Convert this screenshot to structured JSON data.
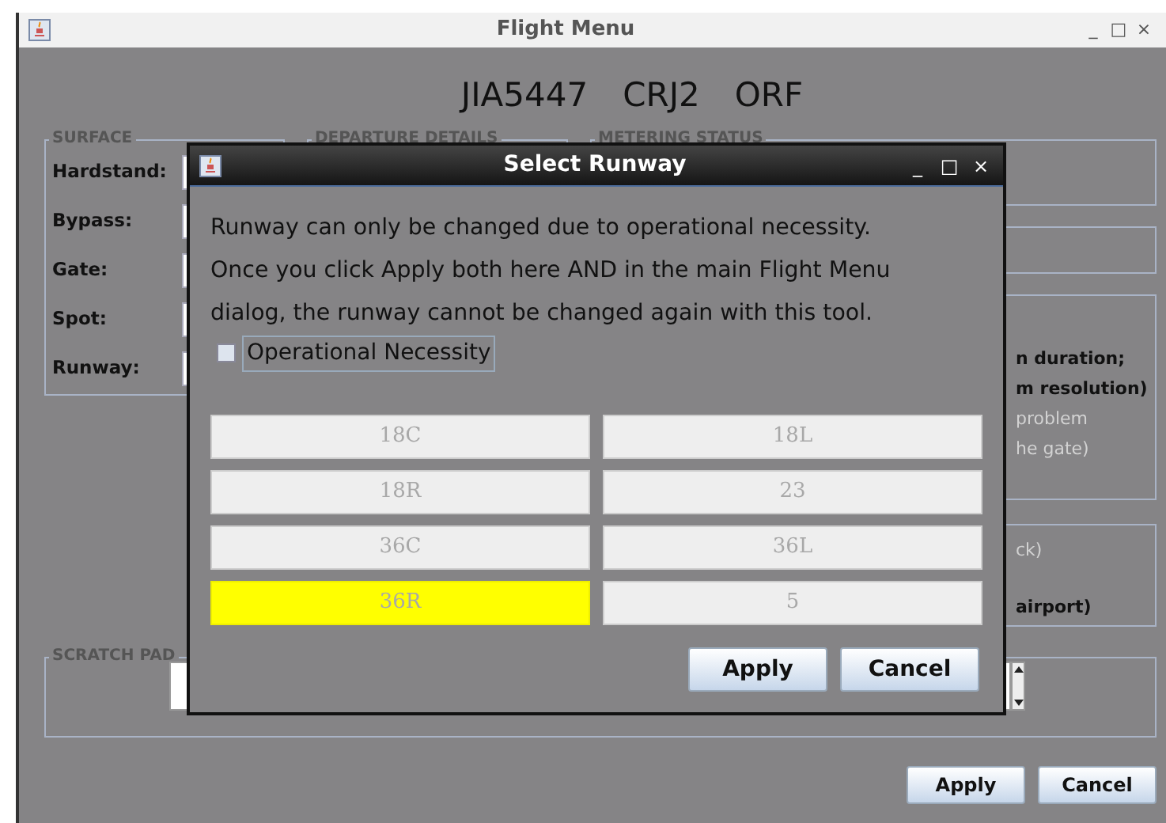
{
  "window": {
    "title": "Flight Menu",
    "controls": [
      "_",
      "□",
      "×"
    ]
  },
  "flight": {
    "callsign": "JIA5447",
    "aircraft": "CRJ2",
    "destination": "ORF"
  },
  "surface": {
    "legend": "SURFACE",
    "fields": [
      {
        "label": "Hardstand:"
      },
      {
        "label": "Bypass:"
      },
      {
        "label": "Gate:"
      },
      {
        "label": "Spot:"
      },
      {
        "label": "Runway:"
      }
    ]
  },
  "departure_details": {
    "legend": "DEPARTURE DETAILS"
  },
  "metering_status": {
    "legend": "METERING STATUS"
  },
  "status_panel": {
    "lines": [
      {
        "text": "n duration;",
        "disabled": false
      },
      {
        "text": "m resolution)",
        "disabled": false
      },
      {
        "text": "problem",
        "disabled": true
      },
      {
        "text": "he gate)",
        "disabled": true
      }
    ]
  },
  "location_panel": {
    "lines": [
      {
        "text": "ck)",
        "disabled": true
      },
      {
        "text": "airport)",
        "disabled": false
      }
    ]
  },
  "scratch_pad": {
    "legend": "SCRATCH PAD"
  },
  "buttons": [
    "Apply",
    "Cancel"
  ],
  "dialog": {
    "title": "Select Runway",
    "controls": [
      "_",
      "□",
      "×"
    ],
    "message": [
      "Runway can only be changed due to operational necessity.",
      "Once you click Apply both here AND in the main Flight Menu",
      "dialog, the runway cannot be changed again with this tool."
    ],
    "checkbox": {
      "label": "Operational Necessity",
      "checked": false
    },
    "runways": [
      {
        "label": "18C",
        "selected": false,
        "disabled": true
      },
      {
        "label": "18L",
        "selected": false,
        "disabled": true
      },
      {
        "label": "18R",
        "selected": false,
        "disabled": true
      },
      {
        "label": "23",
        "selected": false,
        "disabled": true
      },
      {
        "label": "36C",
        "selected": false,
        "disabled": true
      },
      {
        "label": "36L",
        "selected": false,
        "disabled": true
      },
      {
        "label": "36R",
        "selected": true,
        "disabled": true
      },
      {
        "label": "5",
        "selected": false,
        "disabled": true
      }
    ],
    "buttons": [
      "Apply",
      "Cancel"
    ]
  }
}
